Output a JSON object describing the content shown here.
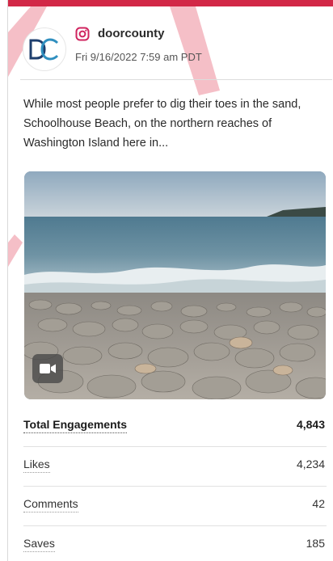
{
  "colors": {
    "accent": "#d22847",
    "instagram": "#d0245f",
    "avatar_brand": "#1e3f6e"
  },
  "post": {
    "platform_icon": "instagram-icon",
    "account_name": "doorcounty",
    "avatar_text": "DC",
    "timestamp": "Fri 9/16/2022 7:59 am PDT",
    "text": "While most people prefer to dig their toes in the sand, Schoolhouse Beach, on the northern reaches of Washington Island here in...",
    "media": {
      "type": "video",
      "badge_icon": "video-camera-icon"
    }
  },
  "metrics": [
    {
      "label": "Total Engagements",
      "value": "4,843"
    },
    {
      "label": "Likes",
      "value": "4,234"
    },
    {
      "label": "Comments",
      "value": "42"
    },
    {
      "label": "Saves",
      "value": "185"
    }
  ]
}
